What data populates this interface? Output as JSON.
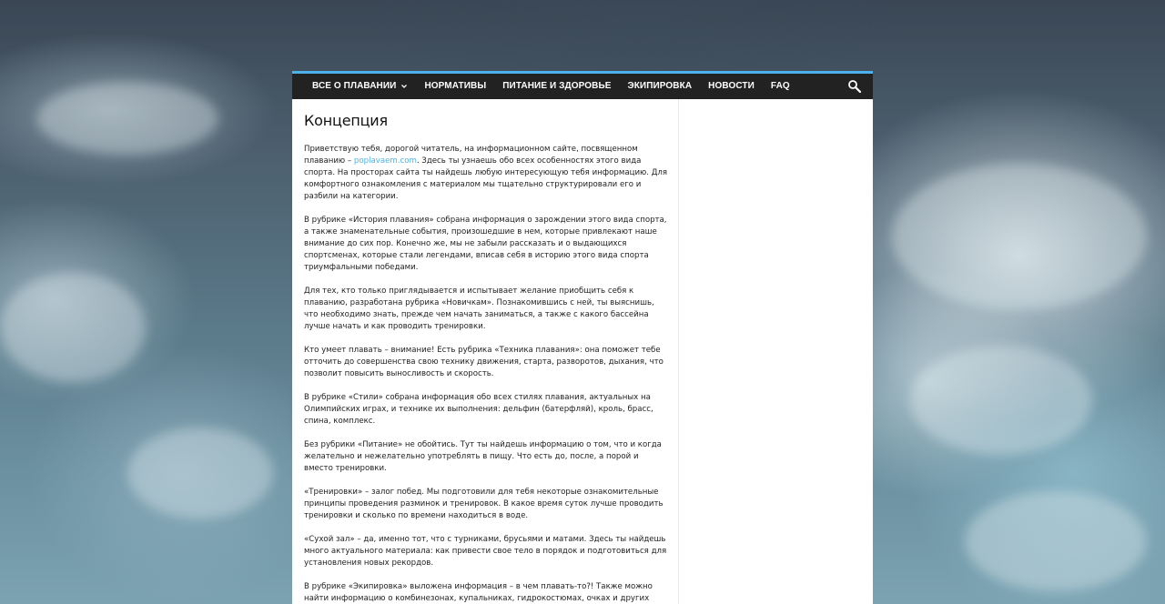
{
  "colors": {
    "accent": "#4db2ec",
    "navbar_bg": "#222222",
    "nav_text": "#ffffff",
    "body_text": "#222222"
  },
  "nav": {
    "items": [
      {
        "label": "ВСЕ О ПЛАВАНИИ",
        "has_dropdown": true
      },
      {
        "label": "НОРМАТИВЫ"
      },
      {
        "label": "ПИТАНИЕ И ЗДОРОВЬЕ"
      },
      {
        "label": "ЭКИПИРОВКА"
      },
      {
        "label": "НОВОСТИ"
      },
      {
        "label": "FAQ"
      }
    ],
    "search_icon": "search-icon",
    "dropdown_icon": "chevron-down-icon"
  },
  "page": {
    "title": "Концепция",
    "p1_before": "Приветствую тебя, дорогой читатель, на информационном сайте, посвященном плаванию – ",
    "p1_link": "poplavaem.com",
    "p1_after": ". Здесь ты узнаешь обо всех особенностях этого вида спорта. На просторах сайта ты найдешь любую интересующую тебя информацию. Для комфортного ознакомления с материалом мы тщательно структурировали его и разбили на категории.",
    "paragraphs": [
      "В рубрике «История плавания» собрана информация о зарождении этого вида спорта, а также знаменательные события, произошедшие в нем, которые привлекают наше внимание до сих пор. Конечно же, мы не забыли рассказать и о выдающихся спортсменах, которые стали легендами, вписав себя в историю этого вида спорта триумфальными победами.",
      "Для тех, кто только приглядывается и испытывает желание приобщить себя к плаванию, разработана рубрика «Новичкам». Познакомившись с ней, ты выяснишь, что необходимо знать, прежде чем начать заниматься, а также с какого бассейна лучше начать и как проводить тренировки.",
      "Кто умеет плавать – внимание! Есть рубрика «Техника плавания»: она поможет тебе отточить до совершенства свою технику движения, старта, разворотов, дыхания, что позволит повысить выносливость и скорость.",
      "В рубрике «Стили» собрана информация обо всех стилях плавания, актуальных на Олимпийских играх, и технике их выполнения: дельфин (батерфляй), кроль, брасс, спина, комплекс.",
      "Без рубрики «Питание» не обойтись. Тут ты найдешь информацию о том, что и когда желательно и нежелательно употреблять в пищу. Что есть до, после, а порой и вместо тренировки.",
      "«Тренировки» – залог побед. Мы подготовили для тебя некоторые ознакомительные принципы проведения разминок и тренировок. В какое время суток лучше проводить тренировки и сколько по времени находиться в воде.",
      "«Сухой зал» – да, именно тот, что с турниками, брусьями и матами. Здесь ты найдешь много актуального материала: как привести свое тело в порядок и подготовиться для установления новых рекордов.",
      "В рубрике «Экипировка» выложена информация – в чем плавать-то?! Также можно найти информацию о комбинезонах, купальниках, гидрокостюмах, очках и других атрибутах современного плавания, и как это всё подобрать для себя."
    ]
  }
}
